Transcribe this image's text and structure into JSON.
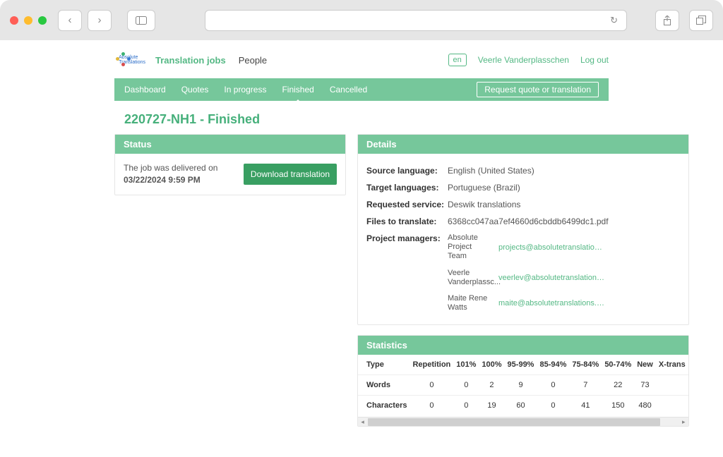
{
  "header": {
    "nav_primary": [
      {
        "label": "Translation jobs",
        "active": true
      },
      {
        "label": "People",
        "active": false
      }
    ],
    "lang": "en",
    "user_name": "Veerle Vanderplasschen",
    "logout": "Log out"
  },
  "navbar": {
    "tabs": [
      {
        "label": "Dashboard",
        "active": false
      },
      {
        "label": "Quotes",
        "active": false
      },
      {
        "label": "In progress",
        "active": false
      },
      {
        "label": "Finished",
        "active": true
      },
      {
        "label": "Cancelled",
        "active": false
      }
    ],
    "cta": "Request quote or translation"
  },
  "page_title": "220727-NH1 - Finished",
  "status": {
    "header": "Status",
    "text_prefix": "The job was delivered on ",
    "text_date": "03/22/2024 9:59 PM",
    "button": "Download translation"
  },
  "details": {
    "header": "Details",
    "rows": [
      {
        "label": "Source language:",
        "value": "English (United States)"
      },
      {
        "label": "Target languages:",
        "value": "Portuguese (Brazil)"
      },
      {
        "label": "Requested service:",
        "value": "Deswik translations"
      },
      {
        "label": "Files to translate:",
        "value": "6368cc047aa7ef4660d6cbddb6499dc1.pdf"
      }
    ],
    "pm_label": "Project managers:",
    "pms": [
      {
        "name": "Absolute Project Team",
        "email": "projects@absolutetranslations.co"
      },
      {
        "name": "Veerle Vanderplassc...",
        "email": "veerlev@absolutetranslations.con"
      },
      {
        "name": "Maite Rene Watts",
        "email": "maite@absolutetranslations.com."
      }
    ]
  },
  "statistics": {
    "header": "Statistics",
    "columns": [
      "Type",
      "Repetition",
      "101%",
      "100%",
      "95-99%",
      "85-94%",
      "75-84%",
      "50-74%",
      "New",
      "X-trans"
    ],
    "rows": [
      {
        "type": "Words",
        "vals": [
          "0",
          "0",
          "2",
          "9",
          "0",
          "7",
          "22",
          "73"
        ]
      },
      {
        "type": "Characters",
        "vals": [
          "0",
          "0",
          "19",
          "60",
          "0",
          "41",
          "150",
          "480"
        ]
      }
    ]
  }
}
